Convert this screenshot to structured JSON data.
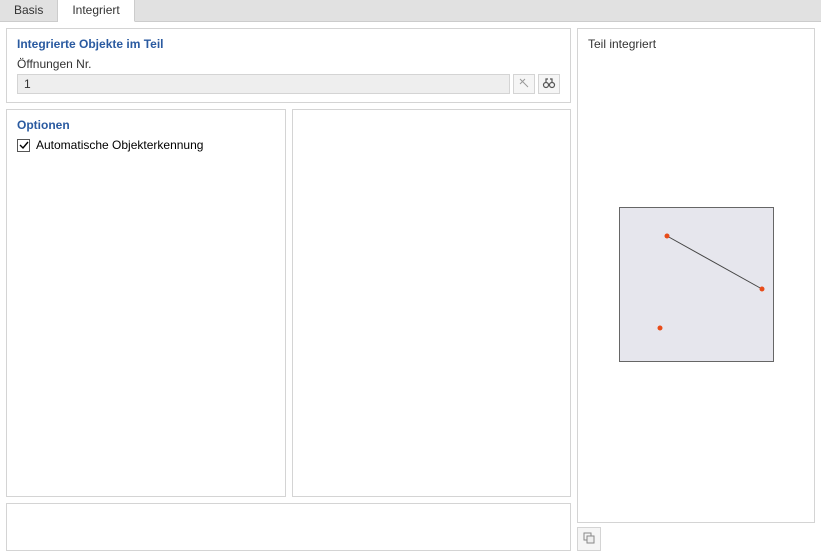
{
  "tabs": {
    "basis": "Basis",
    "integriert": "Integriert"
  },
  "integrated_objects": {
    "title": "Integrierte Objekte im Teil",
    "openings_label": "Öffnungen Nr.",
    "openings_value": "1"
  },
  "options": {
    "title": "Optionen",
    "auto_detection_label": "Automatische Objekterkennung",
    "auto_detection_checked": true
  },
  "preview": {
    "title": "Teil integriert"
  }
}
